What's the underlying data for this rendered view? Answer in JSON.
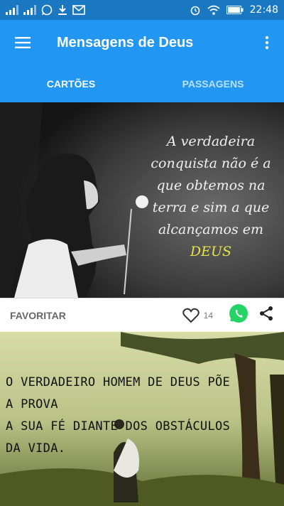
{
  "status_bar": {
    "time": "22:48",
    "icons": [
      "signal-icon",
      "signal-icon",
      "whatsapp-icon",
      "download-icon",
      "mail-icon",
      "alarm-icon",
      "wifi-icon",
      "battery-icon"
    ]
  },
  "app_bar": {
    "title": "Mensagens de Deus",
    "menu_icon": "hamburger-menu-icon",
    "overflow_icon": "more-vert-icon"
  },
  "tabs": [
    {
      "label": "CARTÕES",
      "active": true
    },
    {
      "label": "PASSAGENS",
      "active": false
    }
  ],
  "cards": [
    {
      "quote_lines": [
        "A verdadeira",
        "conquista não é a",
        "que obtemos na",
        "terra e sim a que",
        "alcançamos em"
      ],
      "quote_highlight": "DEUS",
      "favorite_label": "FAVORITAR",
      "like_count": "14"
    },
    {
      "quote_lines": [
        "O VERDADEIRO HOMEM DE DEUS PÕE A PROVA",
        "A SUA FÉ DIANTE DOS OBSTÁCULOS DA VIDA."
      ]
    }
  ],
  "colors": {
    "status_bar": "#1a78c2",
    "app_bar": "#2196f3",
    "tab_indicator": "#ffffff",
    "whatsapp": "#25d366",
    "highlight": "#e5e34a"
  }
}
